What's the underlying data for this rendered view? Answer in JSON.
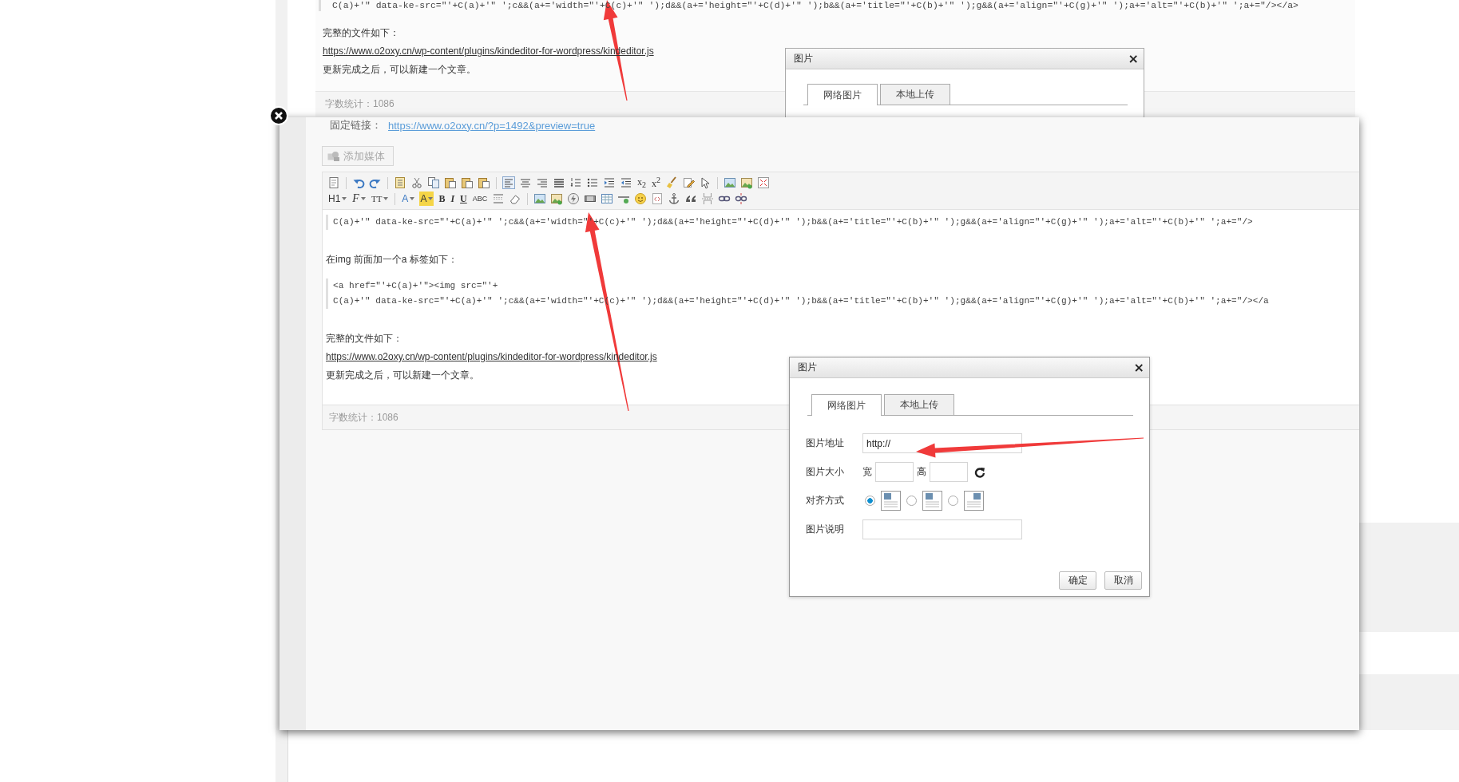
{
  "background_page": {
    "code_line": "C(a)+'\" data-ke-src=\"'+C(a)+'\" ';c&&(a+='width=\"'+C(c)+'\" ');d&&(a+='height=\"'+C(d)+'\" ');b&&(a+='title=\"'+C(b)+'\" ');g&&(a+='align=\"'+C(g)+'\" ');a+='alt=\"'+C(b)+'\" ';a+=\"/></a>",
    "paragraphs": [
      {
        "kind": "text",
        "text": "完整的文件如下："
      },
      {
        "kind": "link",
        "text": "https://www.o2oxy.cn/wp-content/plugins/kindeditor-for-wordpress/kindeditor.js"
      },
      {
        "kind": "text",
        "text": "更新完成之后，可以新建一个文章。"
      }
    ],
    "word_count": "字数统计：1086"
  },
  "background_dialog": {
    "title": "图片",
    "close": "×",
    "tabs": [
      {
        "label": "网络图片",
        "selected": true
      },
      {
        "label": "本地上传",
        "selected": false
      }
    ]
  },
  "editor": {
    "permalink_label": "固定链接：",
    "permalink_url": "https://www.o2oxy.cn/?p=1492&preview=true",
    "add_media": "添加媒体",
    "toolbar": [
      [
        {
          "kind": "icon"
        },
        {
          "kind": "sep"
        },
        {
          "kind": "icon"
        },
        {
          "kind": "icon"
        },
        {
          "kind": "sep"
        },
        {
          "kind": "icon"
        },
        {
          "kind": "icon"
        },
        {
          "kind": "icon"
        },
        {
          "kind": "icon"
        },
        {
          "kind": "icon"
        },
        {
          "kind": "icon"
        },
        {
          "kind": "sep"
        },
        {
          "kind": "icon"
        },
        {
          "kind": "icon"
        },
        {
          "kind": "icon"
        },
        {
          "kind": "icon"
        },
        {
          "kind": "icon"
        },
        {
          "kind": "icon"
        },
        {
          "kind": "icon"
        },
        {
          "kind": "icon"
        },
        {
          "kind": "text",
          "label": "x$_{2}$",
          "dropdown": false
        },
        {
          "kind": "text",
          "label": "x$^{2}$",
          "dropdown": false
        },
        {
          "kind": "icon"
        },
        {
          "kind": "icon"
        },
        {
          "kind": "icon"
        },
        {
          "kind": "sep"
        },
        {
          "kind": "icon"
        },
        {
          "kind": "icon"
        },
        {
          "kind": "icon"
        }
      ],
      [
        {
          "kind": "text",
          "label": "H1",
          "dropdown": true
        },
        {
          "kind": "text",
          "label": "F",
          "dropdown": true
        },
        {
          "kind": "text",
          "label": "TT",
          "dropdown": true
        },
        {
          "kind": "sep"
        },
        {
          "kind": "text",
          "label": "A",
          "dropdown": true
        },
        {
          "kind": "text",
          "label": "A",
          "dropdown": true
        },
        {
          "kind": "text",
          "label": "B",
          "dropdown": false
        },
        {
          "kind": "text",
          "label": "I",
          "dropdown": false
        },
        {
          "kind": "text",
          "label": "U",
          "dropdown": false
        },
        {
          "kind": "text",
          "label": "ABC",
          "dropdown": false
        },
        {
          "kind": "icon"
        },
        {
          "kind": "icon"
        },
        {
          "kind": "sep"
        },
        {
          "kind": "icon"
        },
        {
          "kind": "icon"
        },
        {
          "kind": "icon"
        },
        {
          "kind": "icon"
        },
        {
          "kind": "icon"
        },
        {
          "kind": "icon"
        },
        {
          "kind": "icon"
        },
        {
          "kind": "icon"
        },
        {
          "kind": "icon"
        },
        {
          "kind": "icon"
        },
        {
          "kind": "icon"
        },
        {
          "kind": "icon"
        },
        {
          "kind": "icon"
        }
      ]
    ],
    "content": [
      {
        "kind": "code",
        "lines": [
          "C(a)+'\" data-ke-src=\"'+C(a)+'\" ';c&&(a+='width=\"'+C(c)+'\" ');d&&(a+='height=\"'+C(d)+'\" ');b&&(a+='title=\"'+C(b)+'\" ');g&&(a+='align=\"'+C(g)+'\" ');a+='alt=\"'+C(b)+'\" ';a+=\"/>"
        ]
      },
      {
        "kind": "text",
        "text": "在img 前面加一个a 标签如下："
      },
      {
        "kind": "code",
        "lines": [
          "<a href=\"'+C(a)+'\"><img src=\"'+",
          "C(a)+'\" data-ke-src=\"'+C(a)+'\" ';c&&(a+='width=\"'+C(c)+'\" ');d&&(a+='height=\"'+C(d)+'\" ');b&&(a+='title=\"'+C(b)+'\" ');g&&(a+='align=\"'+C(g)+'\" ');a+='alt=\"'+C(b)+'\" ';a+=\"/></a"
        ]
      },
      {
        "kind": "text",
        "text": "完整的文件如下："
      },
      {
        "kind": "link",
        "text": "https://www.o2oxy.cn/wp-content/plugins/kindeditor-for-wordpress/kindeditor.js"
      },
      {
        "kind": "text",
        "text": "更新完成之后，可以新建一个文章。"
      }
    ],
    "word_count": "字数统计：1086"
  },
  "dialog": {
    "title": "图片",
    "close": "×",
    "tabs": [
      {
        "label": "网络图片",
        "selected": true
      },
      {
        "label": "本地上传",
        "selected": false
      }
    ],
    "url_label": "图片地址",
    "url_value": "http://",
    "size_label": "图片大小",
    "width_label": "宽",
    "height_label": "高",
    "align_label": "对齐方式",
    "align_options": [
      {
        "selected": true
      },
      {
        "selected": false
      },
      {
        "selected": false
      }
    ],
    "caption_label": "图片说明",
    "buttons": [
      "确定",
      "取消"
    ]
  }
}
